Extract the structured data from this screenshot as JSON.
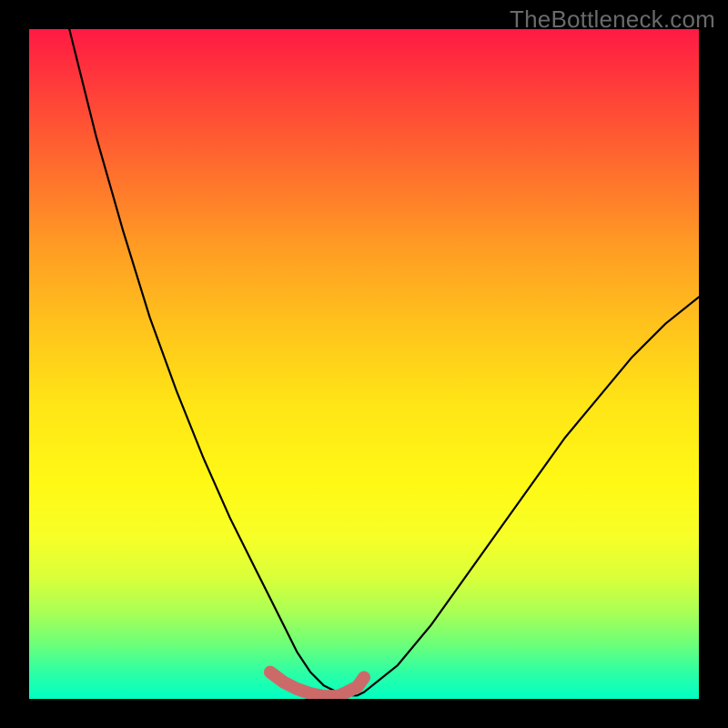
{
  "watermark": {
    "text": "TheBottleneck.com"
  },
  "chart_data": {
    "type": "line",
    "title": "",
    "xlabel": "",
    "ylabel": "",
    "xlim": [
      0,
      100
    ],
    "ylim": [
      0,
      100
    ],
    "background_gradient": {
      "top_color": "#ff1a44",
      "mid_color": "#fff915",
      "bottom_color": "#00ffc4"
    },
    "series": [
      {
        "name": "bottleneck-curve",
        "stroke": "#000000",
        "x": [
          6,
          10,
          14,
          18,
          22,
          26,
          30,
          34,
          36,
          38.5,
          40,
          42,
          44,
          46,
          47,
          49,
          50,
          55,
          60,
          65,
          70,
          75,
          80,
          85,
          90,
          95,
          100
        ],
        "values": [
          100,
          84,
          70,
          57,
          46,
          36,
          27,
          19,
          15,
          10,
          7,
          4,
          2,
          1,
          0.5,
          0.5,
          1,
          5,
          11,
          18,
          25,
          32,
          39,
          45,
          51,
          56,
          60
        ]
      },
      {
        "name": "highlight-band",
        "stroke": "#cc6a6a",
        "thick": true,
        "x": [
          36,
          38,
          40,
          42,
          44,
          46,
          47,
          49,
          50
        ],
        "values": [
          4,
          2.5,
          1.5,
          0.8,
          0.4,
          0.4,
          0.8,
          1.8,
          3.2
        ]
      }
    ]
  }
}
